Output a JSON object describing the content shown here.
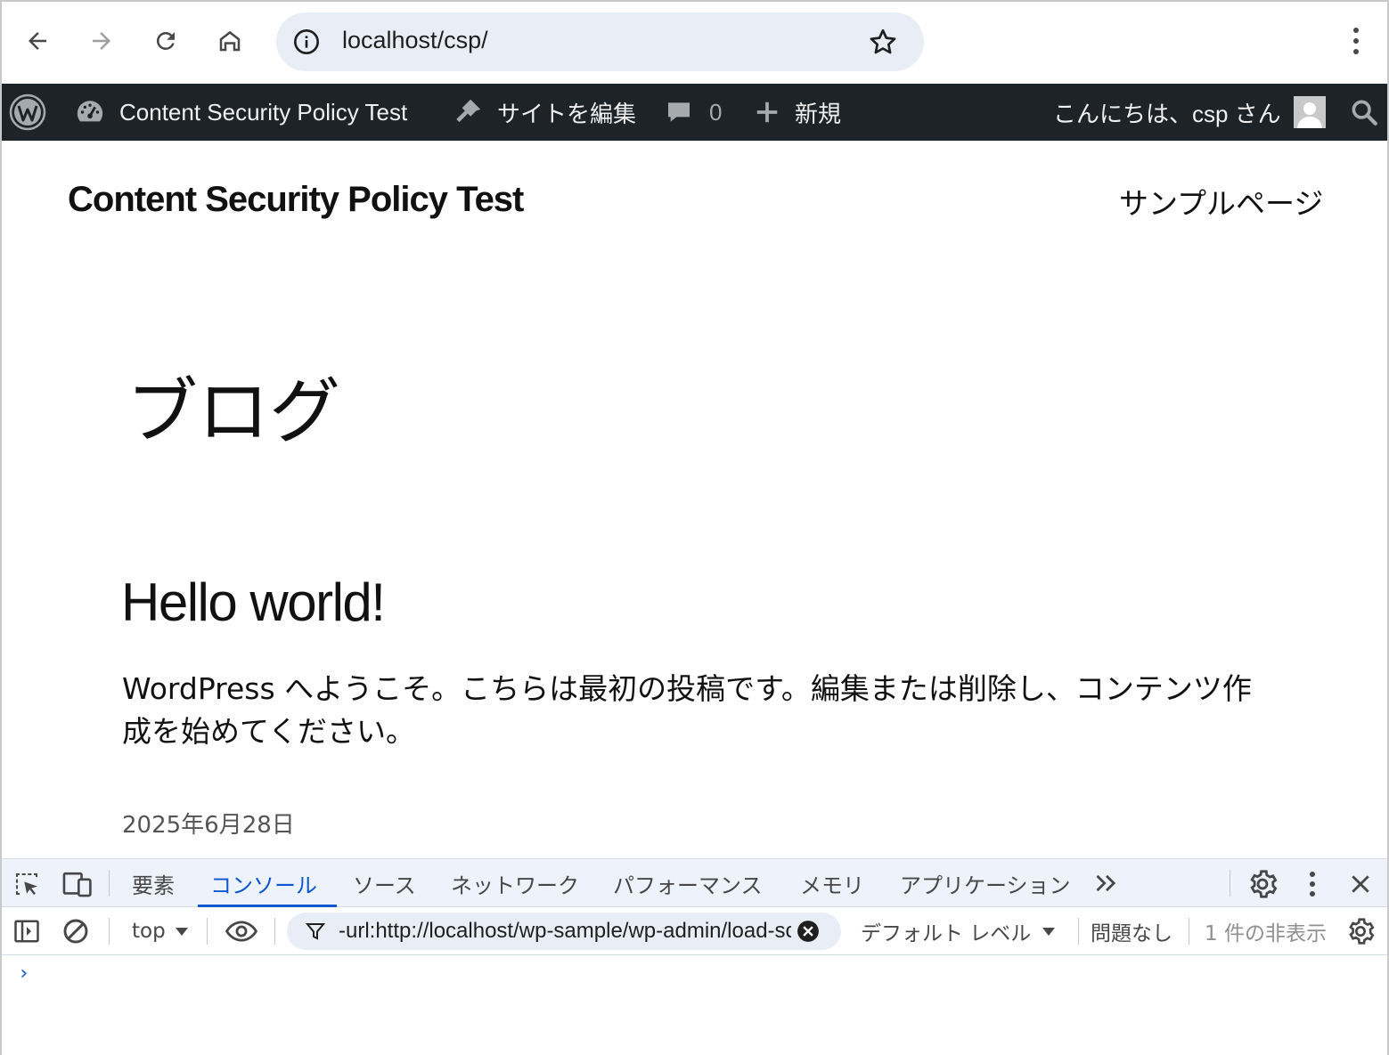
{
  "browser": {
    "url": "localhost/csp/",
    "icons": [
      "back-icon",
      "forward-icon",
      "reload-icon",
      "home-icon",
      "site-info-icon",
      "bookmark-star-icon",
      "more-menu-icon"
    ]
  },
  "wp_admin_bar": {
    "site_name": "Content Security Policy Test",
    "edit_site": "サイトを編集",
    "comments_count": "0",
    "new_label": "新規",
    "greeting": "こんにちは、csp さん"
  },
  "site": {
    "title": "Content Security Policy Test",
    "nav_item": "サンプルページ"
  },
  "main": {
    "page_heading": "ブログ",
    "post": {
      "title": "Hello world!",
      "excerpt": "WordPress へようこそ。こちらは最初の投稿です。編集または削除し、コンテンツ作成を始めてください。",
      "date": "2025年6月28日"
    }
  },
  "devtools": {
    "tabs": [
      "要素",
      "コンソール",
      "ソース",
      "ネットワーク",
      "パフォーマンス",
      "メモリ",
      "アプリケーション"
    ],
    "active_tab": "コンソール",
    "context": "top",
    "filter_value": "-url:http://localhost/wp-sample/wp-admin/load-scripts.php",
    "level": "デフォルト レベル",
    "issues": "問題なし",
    "hidden_count": "1 件の非表示",
    "prompt": "›"
  },
  "colors": {
    "admin_bar": "#1d2327",
    "accent": "#0b57d0",
    "omnibox": "#e9eef6"
  }
}
